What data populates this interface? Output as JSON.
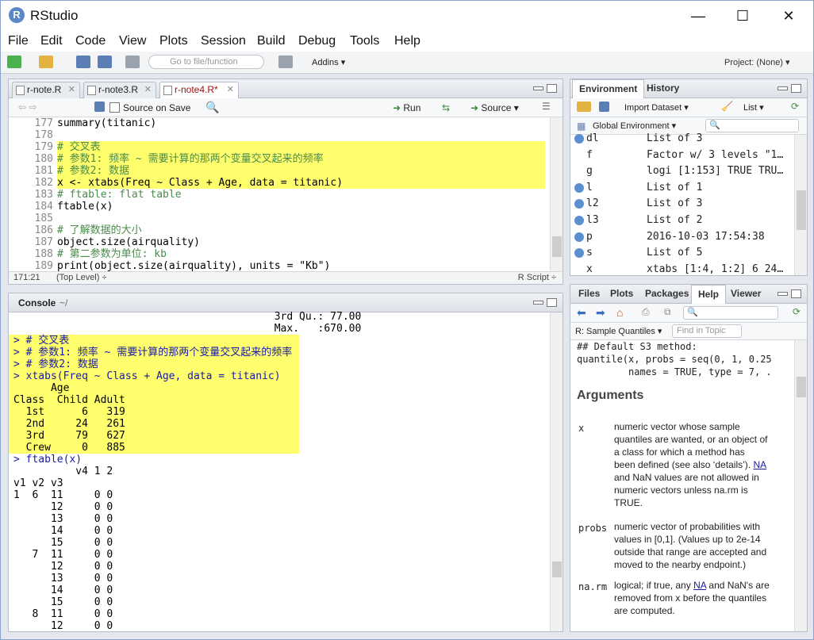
{
  "app": {
    "title": "RStudio",
    "logo": "R"
  },
  "menu": [
    "File",
    "Edit",
    "Code",
    "View",
    "Plots",
    "Session",
    "Build",
    "Debug",
    "Tools",
    "Help"
  ],
  "toolbar": {
    "goto_placeholder": "Go to file/function",
    "addins": "Addins ▾",
    "project": "Project: (None) ▾"
  },
  "editor": {
    "tabs": [
      {
        "label": "r-note.R"
      },
      {
        "label": "r-note3.R"
      },
      {
        "label": "r-note4.R*",
        "active": true
      }
    ],
    "source_on_save": "Source on Save",
    "run": "Run",
    "source": "Source",
    "lines": [
      {
        "n": "177",
        "t": "summary(titanic)",
        "hl": false,
        "c": false
      },
      {
        "n": "178",
        "t": "",
        "hl": false,
        "c": false
      },
      {
        "n": "179",
        "t": "# 交叉表",
        "hl": true,
        "c": true
      },
      {
        "n": "180",
        "t": "# 参数1: 频率 ~ 需要计算的那两个变量交叉起来的频率",
        "hl": true,
        "c": true
      },
      {
        "n": "181",
        "t": "# 参数2: 数据",
        "hl": true,
        "c": true
      },
      {
        "n": "182",
        "t": "x <- xtabs(Freq ~ Class + Age, data = titanic)",
        "hl": true,
        "c": false
      },
      {
        "n": "183",
        "t": "# ftable: flat table",
        "hl": false,
        "c": true
      },
      {
        "n": "184",
        "t": "ftable(x)",
        "hl": false,
        "c": false
      },
      {
        "n": "185",
        "t": "",
        "hl": false,
        "c": false
      },
      {
        "n": "186",
        "t": "# 了解数据的大小",
        "hl": false,
        "c": true
      },
      {
        "n": "187",
        "t": "object.size(airquality)",
        "hl": false,
        "c": false
      },
      {
        "n": "188",
        "t": "# 第二参数为单位: kb",
        "hl": false,
        "c": true
      },
      {
        "n": "189",
        "t": "print(object.size(airquality), units = \"Kb\")",
        "hl": false,
        "c": false
      }
    ],
    "cursor": "171:21",
    "scope": "(Top Level) ÷",
    "filetype": "R Script ÷"
  },
  "console": {
    "title": "Console",
    "path": "~/",
    "lines": [
      {
        "t": "                                          3rd Qu.: 77.00",
        "hl": false,
        "p": false
      },
      {
        "t": "                                          Max.   :670.00",
        "hl": false,
        "p": false
      },
      {
        "t": "> # 交叉表",
        "hl": true,
        "p": true
      },
      {
        "t": "> # 参数1: 频率 ~ 需要计算的那两个变量交叉起来的频率",
        "hl": true,
        "p": true
      },
      {
        "t": "> # 参数2: 数据",
        "hl": true,
        "p": true
      },
      {
        "t": "> xtabs(Freq ~ Class + Age, data = titanic)",
        "hl": true,
        "p": true
      },
      {
        "t": "      Age",
        "hl": true,
        "p": false
      },
      {
        "t": "Class  Child Adult",
        "hl": true,
        "p": false
      },
      {
        "t": "  1st      6   319",
        "hl": true,
        "p": false
      },
      {
        "t": "  2nd     24   261",
        "hl": true,
        "p": false
      },
      {
        "t": "  3rd     79   627",
        "hl": true,
        "p": false
      },
      {
        "t": "  Crew     0   885",
        "hl": true,
        "p": false
      },
      {
        "t": "> ftable(x)",
        "hl": false,
        "p": true
      },
      {
        "t": "          v4 1 2",
        "hl": false,
        "p": false
      },
      {
        "t": "v1 v2 v3",
        "hl": false,
        "p": false
      },
      {
        "t": "1  6  11     0 0",
        "hl": false,
        "p": false
      },
      {
        "t": "      12     0 0",
        "hl": false,
        "p": false
      },
      {
        "t": "      13     0 0",
        "hl": false,
        "p": false
      },
      {
        "t": "      14     0 0",
        "hl": false,
        "p": false
      },
      {
        "t": "      15     0 0",
        "hl": false,
        "p": false
      },
      {
        "t": "   7  11     0 0",
        "hl": false,
        "p": false
      },
      {
        "t": "      12     0 0",
        "hl": false,
        "p": false
      },
      {
        "t": "      13     0 0",
        "hl": false,
        "p": false
      },
      {
        "t": "      14     0 0",
        "hl": false,
        "p": false
      },
      {
        "t": "      15     0 0",
        "hl": false,
        "p": false
      },
      {
        "t": "   8  11     0 0",
        "hl": false,
        "p": false
      },
      {
        "t": "      12     0 0",
        "hl": false,
        "p": false
      }
    ]
  },
  "environment": {
    "tabs": [
      "Environment",
      "History"
    ],
    "import_dataset": "Import Dataset ▾",
    "list_view": "List ▾",
    "scope": "Global Environment ▾",
    "rows": [
      {
        "name": "dl",
        "value": "List of 3",
        "icon": true
      },
      {
        "name": "f",
        "value": "Factor w/ 3 levels \"1…",
        "icon": false
      },
      {
        "name": "g",
        "value": "logi [1:153] TRUE TRU…",
        "icon": false
      },
      {
        "name": "l",
        "value": "List of 1",
        "icon": true
      },
      {
        "name": "l2",
        "value": "List of 3",
        "icon": true
      },
      {
        "name": "l3",
        "value": "List of 2",
        "icon": true
      },
      {
        "name": "p",
        "value": "2016-10-03 17:54:38",
        "icon": true
      },
      {
        "name": "s",
        "value": "List of 5",
        "icon": true
      },
      {
        "name": "x",
        "value": "xtabs [1:4, 1:2] 6 24…",
        "icon": false
      }
    ]
  },
  "help": {
    "tabs": [
      "Files",
      "Plots",
      "Packages",
      "Help",
      "Viewer"
    ],
    "topic": "R: Sample Quantiles ▾",
    "find_placeholder": "Find in Topic",
    "code1": "## Default S3 method:",
    "code2": "quantile(x, probs = seq(0, 1, 0.25",
    "code3": "         names = TRUE, type = 7, .",
    "heading": "Arguments",
    "arg_x": "x",
    "arg_x_text1": "numeric vector whose sample",
    "arg_x_text2": "quantiles are wanted, or an object of",
    "arg_x_text3": "a class for which a method has",
    "arg_x_text4a": "been defined (see also ‘details’).",
    "arg_x_na": "NA",
    "arg_x_text5": "and NaN values are not allowed in",
    "arg_x_text6": "numeric vectors unless na.rm is",
    "arg_x_text7": "TRUE.",
    "arg_probs": "probs",
    "arg_probs_1": "numeric vector of probabilities with",
    "arg_probs_2": "values in [0,1]. (Values up to 2e-14",
    "arg_probs_3": "outside that range are accepted and",
    "arg_probs_4": "moved to the nearby endpoint.)",
    "arg_narm": "na.rm",
    "arg_narm_1a": "logical; if true, any",
    "arg_narm_na": "NA",
    "arg_narm_1b": "and NaN's are",
    "arg_narm_2": "removed from x before the quantiles",
    "arg_narm_3": "are computed."
  }
}
